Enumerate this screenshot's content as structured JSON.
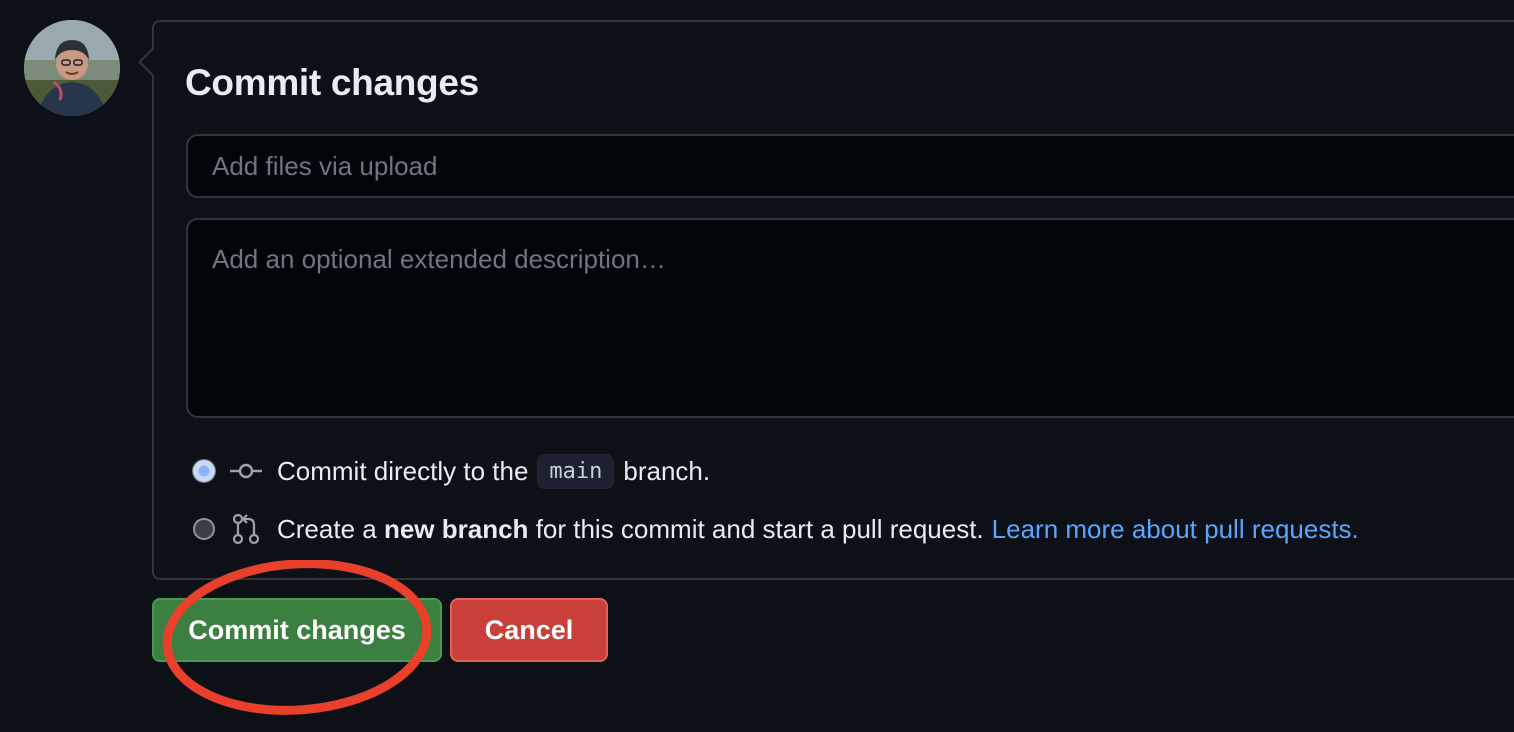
{
  "form": {
    "title": "Commit changes",
    "summary_placeholder": "Add files via upload",
    "description_placeholder": "Add an optional extended description…",
    "option_direct": {
      "prefix": "Commit directly to the",
      "branch": "main",
      "suffix": "branch.",
      "selected": true
    },
    "option_new_branch": {
      "prefix": "Create a",
      "bold": "new branch",
      "suffix": "for this commit and start a pull request.",
      "link": "Learn more about pull requests.",
      "selected": false
    }
  },
  "buttons": {
    "commit_label": "Commit changes",
    "cancel_label": "Cancel"
  },
  "colors": {
    "background": "#0d1117",
    "commit_button": "#3b8040",
    "cancel_button": "#c9403a",
    "link": "#58a6ff",
    "annotation_circle": "#e8402a"
  },
  "icons": {
    "commit_option": "git-commit-icon",
    "branch_option": "git-pull-request-icon"
  }
}
